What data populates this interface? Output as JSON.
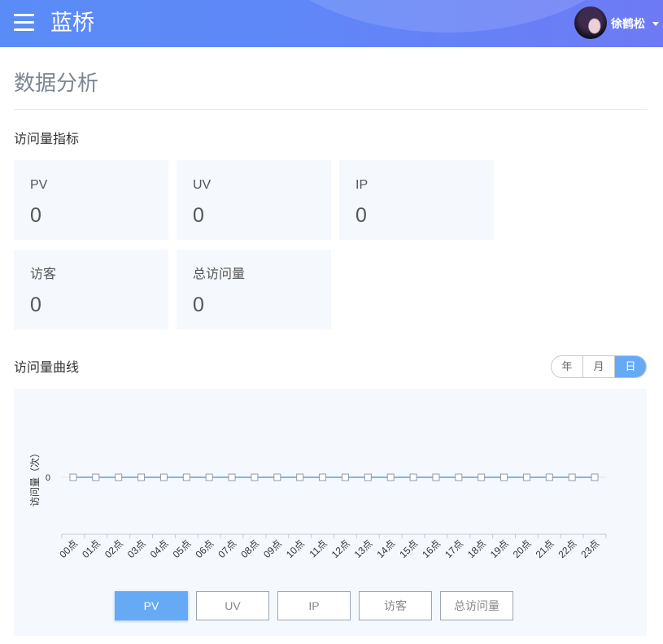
{
  "colors": {
    "accent": "#66aaf5",
    "card_bg": "#f5f8fc",
    "header_from": "#5a8cf7",
    "header_to": "#6e7af5"
  },
  "header": {
    "menu_icon": "menu-icon",
    "title": "蓝桥",
    "user_name": "徐鹤松",
    "dropdown_icon": "caret-down-icon"
  },
  "page": {
    "title": "数据分析"
  },
  "metrics": {
    "section_title": "访问量指标",
    "cards": [
      {
        "label": "PV",
        "value": 0
      },
      {
        "label": "UV",
        "value": 0
      },
      {
        "label": "IP",
        "value": 0
      },
      {
        "label": "访客",
        "value": 0
      },
      {
        "label": "总访问量",
        "value": 0
      }
    ]
  },
  "trend": {
    "section_title": "访问量曲线",
    "range_tabs": [
      {
        "label": "年",
        "active": false
      },
      {
        "label": "月",
        "active": false
      },
      {
        "label": "日",
        "active": true
      }
    ],
    "metric_buttons": [
      {
        "label": "PV",
        "active": true
      },
      {
        "label": "UV",
        "active": false
      },
      {
        "label": "IP",
        "active": false
      },
      {
        "label": "访客",
        "active": false
      },
      {
        "label": "总访问量",
        "active": false
      }
    ]
  },
  "chart_data": {
    "type": "line",
    "categories": [
      "00点",
      "01点",
      "02点",
      "03点",
      "04点",
      "05点",
      "06点",
      "07点",
      "08点",
      "09点",
      "10点",
      "11点",
      "12点",
      "13点",
      "14点",
      "15点",
      "16点",
      "17点",
      "18点",
      "19点",
      "20点",
      "21点",
      "22点",
      "23点"
    ],
    "series": [
      {
        "values": [
          0,
          0,
          0,
          0,
          0,
          0,
          0,
          0,
          0,
          0,
          0,
          0,
          0,
          0,
          0,
          0,
          0,
          0,
          0,
          0,
          0,
          0,
          0,
          0
        ],
        "color": "#7fb6e6"
      }
    ],
    "ylabel": "访问量（次）",
    "y_ticks": [
      0
    ],
    "grid": true
  }
}
